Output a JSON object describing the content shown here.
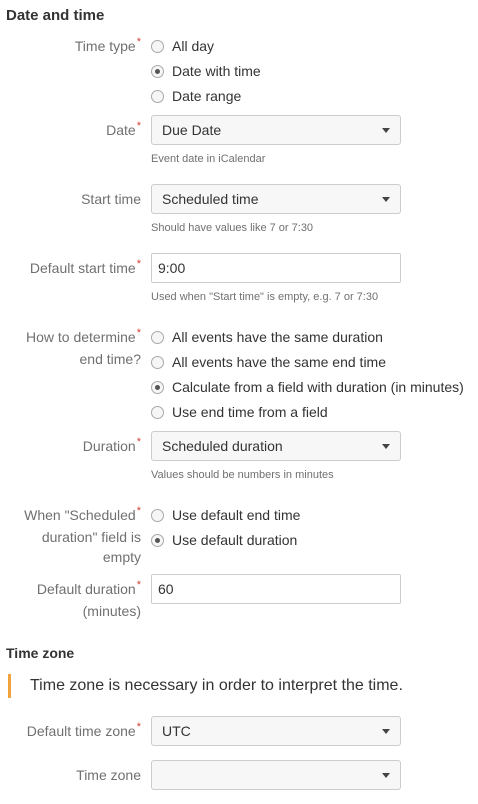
{
  "sections": {
    "date_time": "Date and time",
    "time_zone": "Time zone"
  },
  "required_mark": "*",
  "time_type": {
    "label": "Time type",
    "options": [
      "All day",
      "Date with time",
      "Date range"
    ],
    "selected": "Date with time"
  },
  "date": {
    "label": "Date",
    "value": "Due Date",
    "hint": "Event date in iCalendar"
  },
  "start_time": {
    "label": "Start time",
    "value": "Scheduled time",
    "hint": "Should have values like 7 or 7:30"
  },
  "default_start_time": {
    "label": "Default start time",
    "value": "9:00",
    "hint": "Used when \"Start time\" is empty, e.g. 7 or 7:30"
  },
  "end_time": {
    "label_line1": "How to determine",
    "label_line2": "end time?",
    "options": [
      "All events have the same duration",
      "All events have the same end time",
      "Calculate from a field with duration (in minutes)",
      "Use end time from a field"
    ],
    "selected": "Calculate from a field with duration (in minutes)"
  },
  "duration": {
    "label": "Duration",
    "value": "Scheduled duration",
    "hint": "Values should be numbers in minutes"
  },
  "when_empty": {
    "label_line1": "When \"Scheduled",
    "label_line2": "duration\" field is",
    "label_line3": "empty",
    "options": [
      "Use default end time",
      "Use default duration"
    ],
    "selected": "Use default duration"
  },
  "default_duration": {
    "label_line1": "Default duration",
    "label_line2": "(minutes)",
    "value": "60"
  },
  "tz_info": "Time zone is necessary in order to interpret the time.",
  "default_time_zone": {
    "label": "Default time zone",
    "value": "UTC"
  },
  "time_zone_field": {
    "label": "Time zone",
    "value": ""
  },
  "colors": {
    "required": "#d04437",
    "info_border": "#f0a33a"
  }
}
